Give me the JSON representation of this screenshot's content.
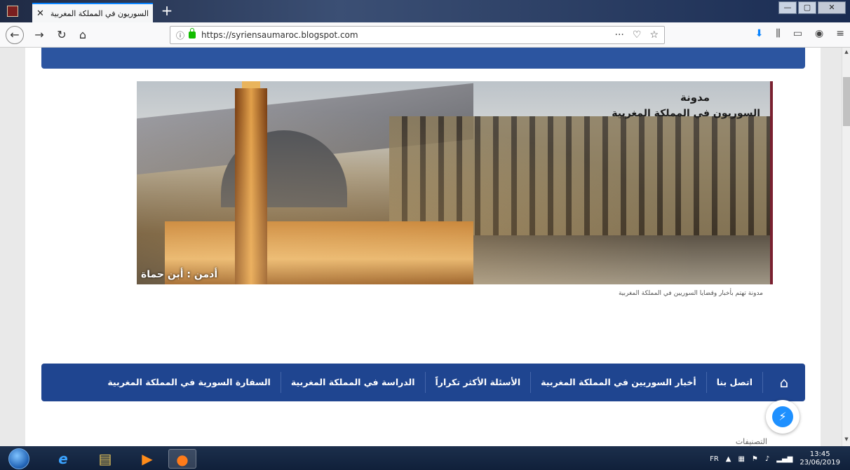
{
  "browser": {
    "tab_title": "السوريون في المملكة المغربية",
    "tab_close": "✕",
    "new_tab": "+",
    "url": "https://syriensaumaroc.blogspot.com",
    "window_controls": [
      "—",
      "▢",
      "✕"
    ]
  },
  "site": {
    "header_title": "مدونة",
    "header_subtitle": "السوريون في المملكة المغربية",
    "admin_label": "أدمن : أبن حماة",
    "description": "مدونة تهتم بأخبار وقضايا السوريين في المملكة المغربية"
  },
  "menu": {
    "home_icon": "home-icon",
    "items": [
      "اتصل بنا",
      "أخبار السوريين في المملكة المغربية",
      "الأسئلة الأكثر تكراراً",
      "الدراسة في المملكة المغربية",
      "السفارة السورية في المملكة المغربية"
    ]
  },
  "peek_text": "التصنيفات",
  "taskbar": {
    "lang": "FR",
    "time": "13:45",
    "date": "23/06/2019"
  },
  "colors": {
    "menu_bg": "#1f4590",
    "top_bar": "#2c55a0",
    "accent": "#0a84ff"
  }
}
